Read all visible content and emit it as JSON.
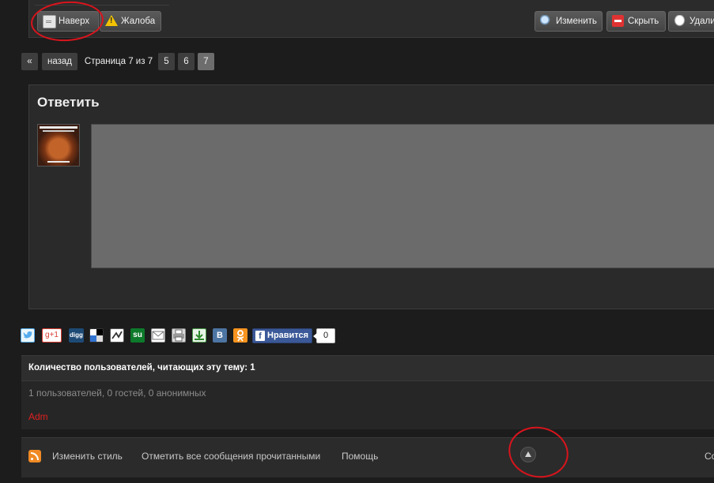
{
  "post_actions": {
    "top_label": "Наверх",
    "report_label": "Жалоба",
    "edit_label": "Изменить",
    "hide_label": "Скрыть",
    "delete_label": "Удали"
  },
  "pagination": {
    "prev_symbol": "«",
    "back_label": "назад",
    "page_info": "Страница 7 из 7",
    "pages": [
      "5",
      "6",
      "7"
    ],
    "current": "7"
  },
  "reply": {
    "title": "Ответить"
  },
  "share": {
    "icons": [
      "twitter-icon",
      "google-plus-icon",
      "digg-icon",
      "delicious-icon",
      "memori-icon",
      "stumbleupon-icon",
      "email-icon",
      "print-icon",
      "download-icon",
      "vkontakte-icon",
      "odnoklassniki-icon"
    ],
    "google_plus_text": "g+1",
    "digg_text": "digg",
    "stumble_text": "su",
    "vk_text": "B",
    "like_label": "Нравится",
    "like_f": "f",
    "like_count": "0"
  },
  "viewers": {
    "header": "Количество пользователей, читающих эту тему: 1",
    "count_text": "1 пользователей, 0 гостей, 0 анонимных",
    "user": "Adm",
    "user_color": "#e02020"
  },
  "footer": {
    "change_style": "Изменить стиль",
    "mark_read": "Отметить все сообщения прочитанными",
    "help": "Помощь",
    "right_text": "Со"
  },
  "colors": {
    "annotation": "#d9141c",
    "like_button": "#3b5998"
  }
}
